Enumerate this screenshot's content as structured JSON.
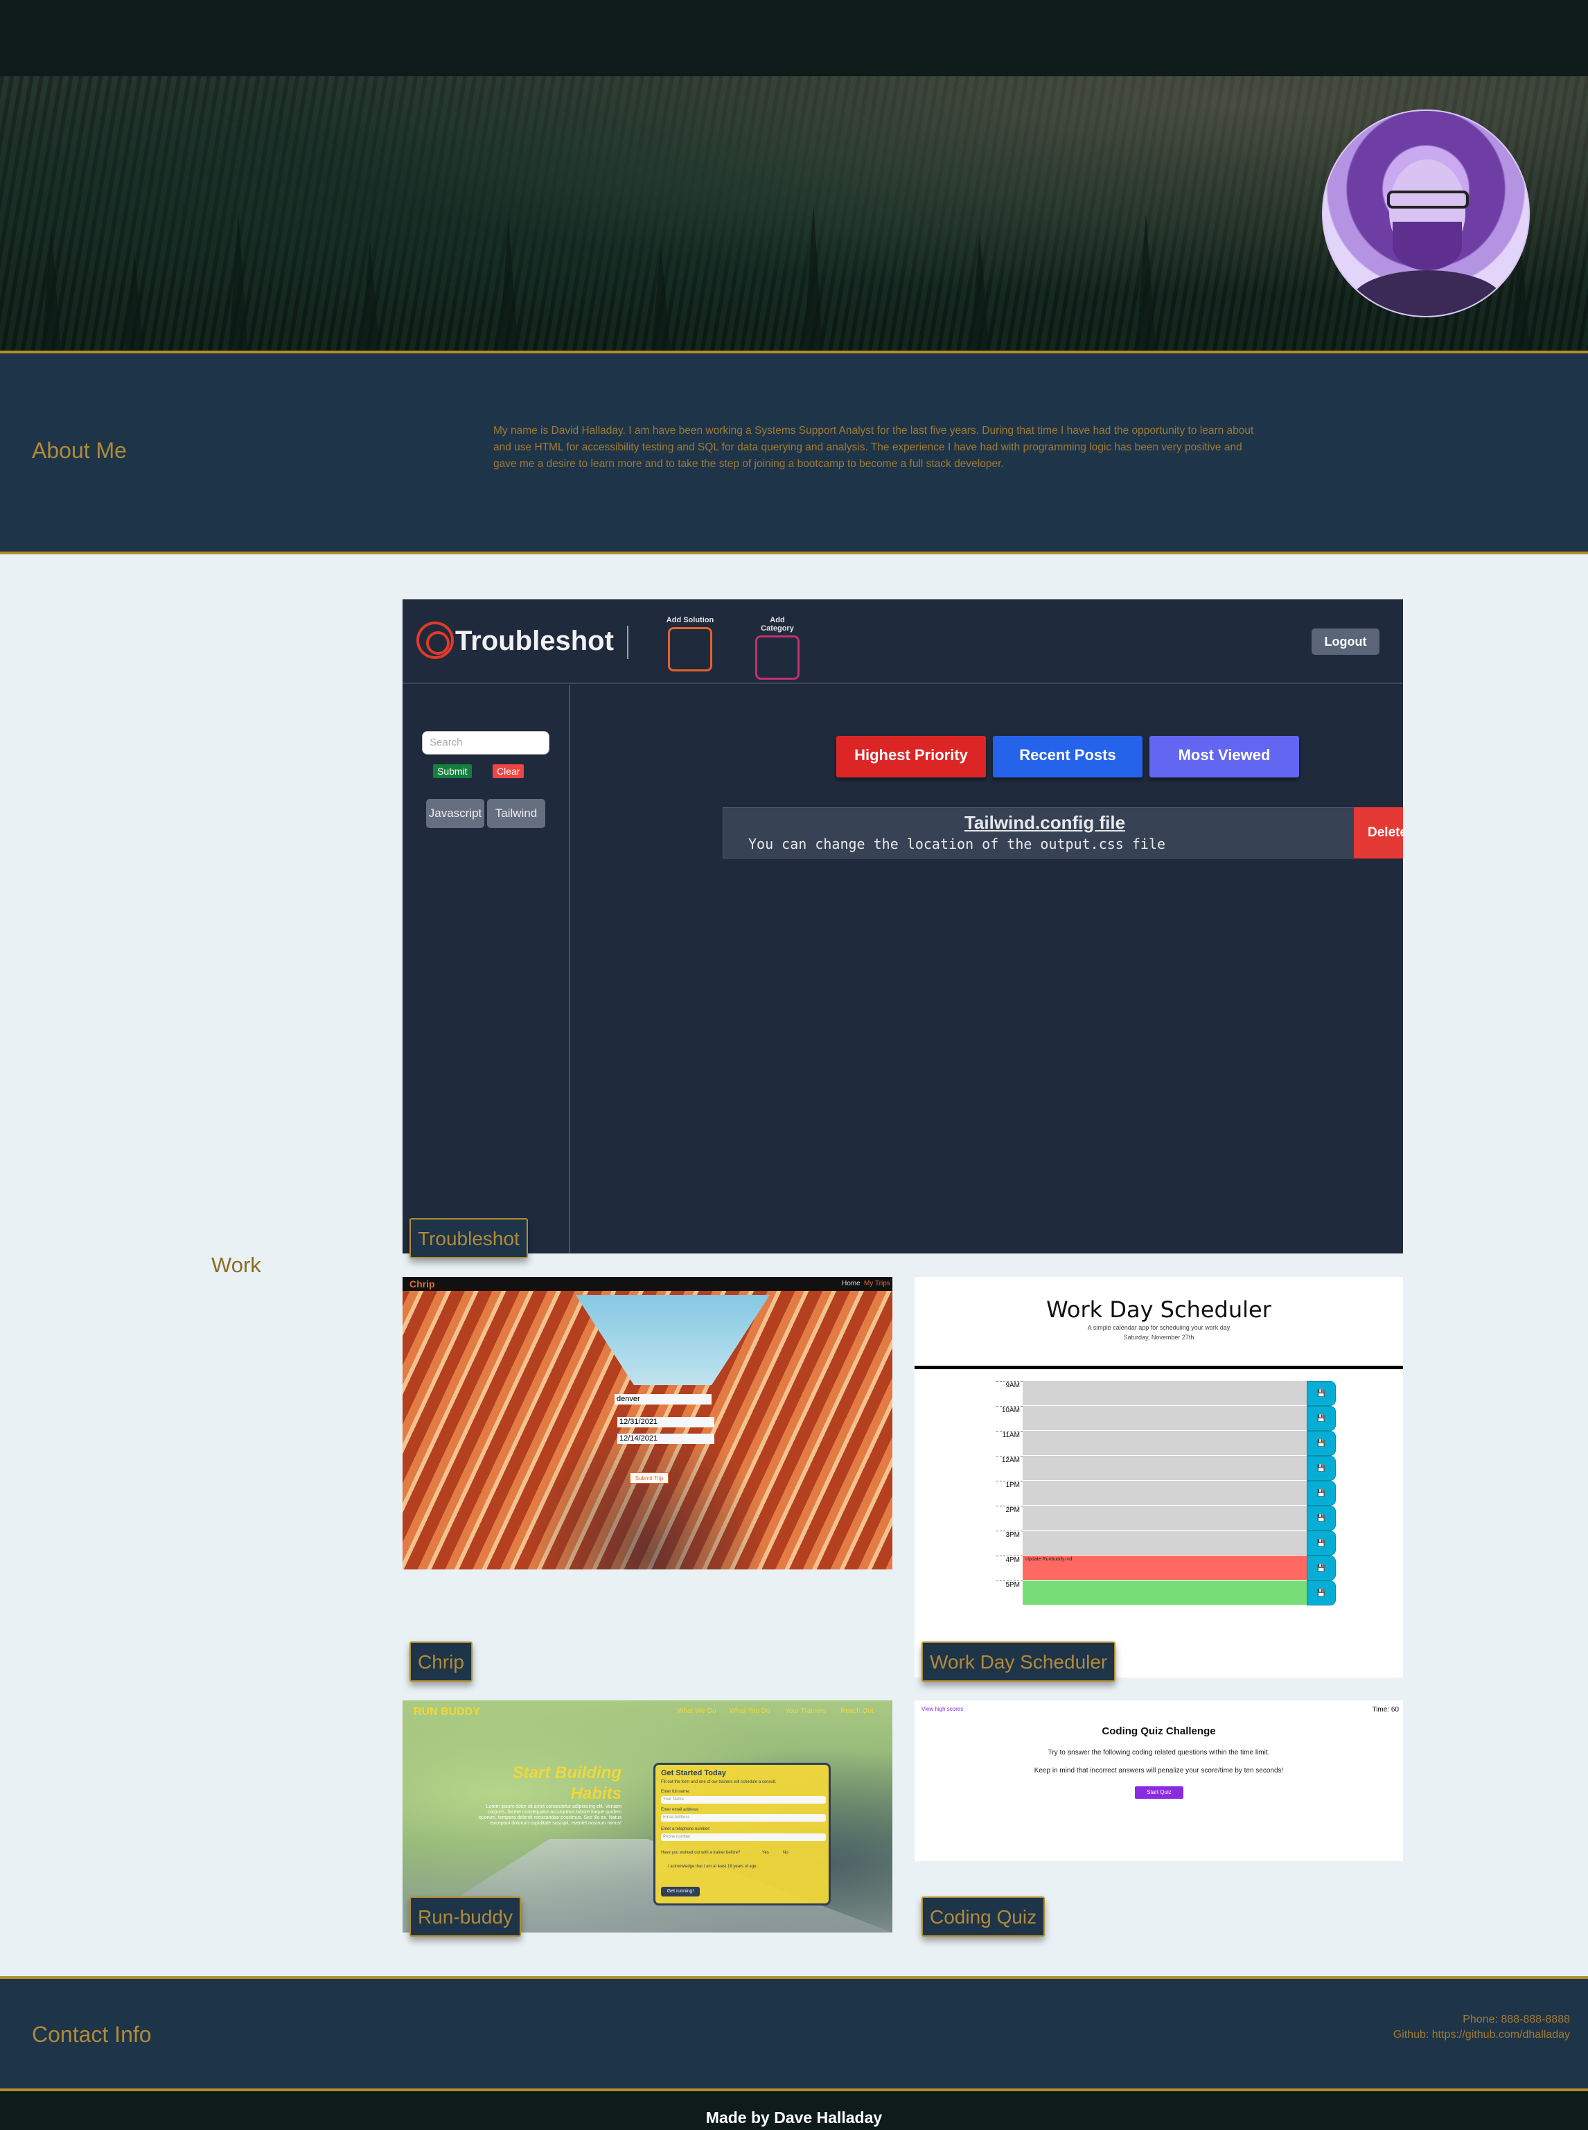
{
  "about": {
    "heading": "About Me",
    "text": "My name is David Halladay. I am have been working a Systems Support Analyst for the last five years. During that time I have had the opportunity to learn about and use HTML for accessibility testing and SQL for data querying and analysis. The experience I have had with programming logic has been very positive and gave me a desire to learn more and to take the step of joining a bootcamp to become a full stack developer."
  },
  "work": {
    "heading": "Work",
    "projects": [
      {
        "label": "Troubleshot"
      },
      {
        "label": "Chrip"
      },
      {
        "label": "Work Day Scheduler"
      },
      {
        "label": "Run-buddy"
      },
      {
        "label": "Coding Quiz"
      }
    ]
  },
  "troubleshot": {
    "app_name": "Troubleshot",
    "add_solution": "Add Solution",
    "add_category": "Add Category",
    "logout": "Logout",
    "search_placeholder": "Search",
    "submit": "Submit",
    "clear": "Clear",
    "tags": [
      "Javascript",
      "Tailwind"
    ],
    "filters": [
      "Highest Priority",
      "Recent Posts",
      "Most Viewed"
    ],
    "post": {
      "title": "Tailwind.config file",
      "body": "You can change the location of the output.css file"
    },
    "delete": "Delete",
    "colors": {
      "bg": "#1f2a3c",
      "highest": "#dc2626",
      "recent": "#2563eb",
      "viewed": "#6366f1",
      "delete": "#e53935",
      "submit": "#15803d",
      "clear": "#ef4444"
    }
  },
  "chrip": {
    "brand": "Chrip",
    "nav": [
      "Home",
      "My Trips"
    ],
    "destination": "denver",
    "date_1": "12/31/2021",
    "date_2": "12/14/2021",
    "submit": "Submit Trip"
  },
  "scheduler": {
    "title": "Work Day Scheduler",
    "subtitle": "A simple calendar app for scheduling your work day",
    "date": "Saturday, November 27th",
    "hours": [
      "9AM",
      "10AM",
      "11AM",
      "12AM",
      "1PM",
      "2PM",
      "3PM",
      "4PM",
      "5PM"
    ],
    "event_text": "Update Runbuddy.md",
    "colors": {
      "past": "#d3d3d3",
      "present": "#ff6961",
      "future": "#77dd77",
      "save": "#06aed5"
    }
  },
  "runbuddy": {
    "brand": "RUN BUDDY",
    "nav": [
      "What We Do",
      "What You Do",
      "Your Trainers",
      "Reach Out"
    ],
    "headline_1": "Start Building",
    "headline_2": "Habits",
    "lorem": "Lorem ipsum dolor sit amet consectetur adipisicing elit. Veniam corporis, facere consequatur accusamus labore itaque quidem quorum, tempora deleniti recusandae possimus. Sed illo ex. Natus excepturi dolorum cupiditate suscipit, eveniet nostrum minus!",
    "form_title": "Get Started Today",
    "form_sub": "Fill out the form and one of our trainers will schedule a consult.",
    "name_label": "Enter full name:",
    "name_ph": "Your Name",
    "email_label": "Enter email address:",
    "email_ph": "Email Address",
    "phone_label": "Enter a telephone number:",
    "phone_ph": "Phone number",
    "trainer_q": "Have you worked out with a trainer before?",
    "yes": "Yes",
    "no": "No",
    "ack": "I acknowledge that I am at least 18 years of age.",
    "cta": "Get running!"
  },
  "quiz": {
    "high_scores": "View high scores",
    "time": "Time: 60",
    "title": "Coding Quiz Challenge",
    "line_1": "Try to answer the following coding related questions within the time limit.",
    "line_2": "Keep in mind that incorrect answers will penalize your score/time by ten seconds!",
    "start": "Start Quiz"
  },
  "contact": {
    "heading": "Contact Info",
    "phone": "Phone: 888-888-8888",
    "github": "Github: https://github.com/dhalladay"
  },
  "footer": {
    "made_by": "Made by Dave Halladay"
  }
}
